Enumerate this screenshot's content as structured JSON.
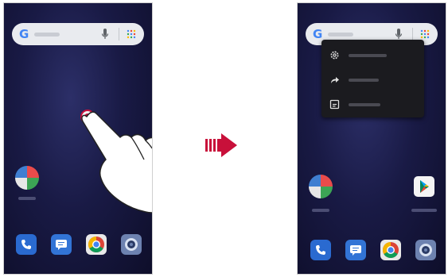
{
  "left_phone": {
    "search": {
      "logo": "G"
    },
    "apps": [
      "folder",
      "phone",
      "messages",
      "chrome",
      "camera"
    ]
  },
  "right_phone": {
    "search": {
      "logo": "G"
    },
    "context_menu": {
      "items": [
        {
          "icon": "gear-icon",
          "label": ""
        },
        {
          "icon": "share-icon",
          "label": ""
        },
        {
          "icon": "widgets-icon",
          "label": ""
        }
      ]
    },
    "apps": [
      "folder",
      "play-store",
      "phone",
      "messages",
      "chrome",
      "camera"
    ]
  },
  "colors": {
    "wallpaper": "#191a45",
    "touch_accent": "#c80f3c",
    "menu_bg": "#1b1b1f",
    "search_bg": "#e9ebef"
  }
}
